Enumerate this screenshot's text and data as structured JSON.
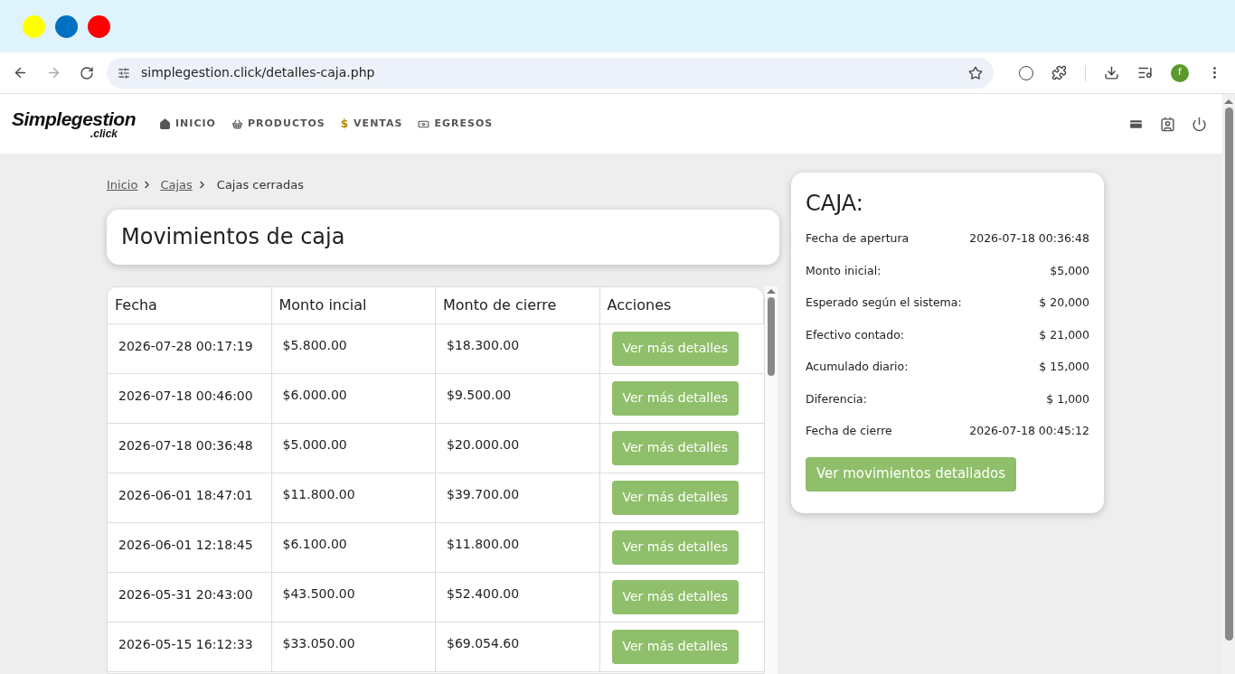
{
  "browser": {
    "url": "simplegestion.click/detalles-caja.php",
    "avatar": "f"
  },
  "header": {
    "logo": {
      "main": "Simplegestion",
      "sub": ".click"
    },
    "nav": [
      {
        "kind": "home",
        "label": "INICIO"
      },
      {
        "kind": "basket",
        "label": "PRODUCTOS"
      },
      {
        "kind": "dollar",
        "label": "VENTAS",
        "glyph": "$"
      },
      {
        "kind": "cash",
        "label": "EGRESOS"
      }
    ]
  },
  "breadcrumb": [
    {
      "label": "Inicio",
      "link": true
    },
    {
      "label": "Cajas",
      "link": true
    },
    {
      "label": "Cajas cerradas",
      "link": false
    }
  ],
  "title": "Movimientos de caja",
  "table": {
    "columns": [
      "Fecha",
      "Monto incial",
      "Monto de cierre",
      "Acciones"
    ],
    "rows": [
      {
        "fecha": "2026-07-28 00:17:19",
        "inicial": "$5.800.00",
        "cierre": "$18.300.00",
        "action": "Ver más detalles"
      },
      {
        "fecha": "2026-07-18 00:46:00",
        "inicial": "$6.000.00",
        "cierre": "$9.500.00",
        "action": "Ver más detalles"
      },
      {
        "fecha": "2026-07-18 00:36:48",
        "inicial": "$5.000.00",
        "cierre": "$20.000.00",
        "action": "Ver más detalles"
      },
      {
        "fecha": "2026-06-01 18:47:01",
        "inicial": "$11.800.00",
        "cierre": "$39.700.00",
        "action": "Ver más detalles"
      },
      {
        "fecha": "2026-06-01 12:18:45",
        "inicial": "$6.100.00",
        "cierre": "$11.800.00",
        "action": "Ver más detalles"
      },
      {
        "fecha": "2026-05-31 20:43:00",
        "inicial": "$43.500.00",
        "cierre": "$52.400.00",
        "action": "Ver más detalles"
      },
      {
        "fecha": "2026-05-15 16:12:33",
        "inicial": "$33.050.00",
        "cierre": "$69.054.60",
        "action": "Ver más detalles"
      }
    ]
  },
  "caja": {
    "title": "CAJA:",
    "fields": [
      {
        "label": "Fecha de apertura",
        "value": "2026-07-18 00:36:48"
      },
      {
        "label": "Monto inicial:",
        "value": "$5,000"
      },
      {
        "label": "Esperado según el sistema:",
        "value": "$ 20,000"
      },
      {
        "label": "Efectivo contado:",
        "value": "$ 21,000"
      },
      {
        "label": "Acumulado diario:",
        "value": "$ 15,000"
      },
      {
        "label": "Diferencia:",
        "value": "$ 1,000"
      },
      {
        "label": "Fecha de cierre",
        "value": "2026-07-18 00:45:12"
      }
    ],
    "button": "Ver movimientos detallados"
  }
}
